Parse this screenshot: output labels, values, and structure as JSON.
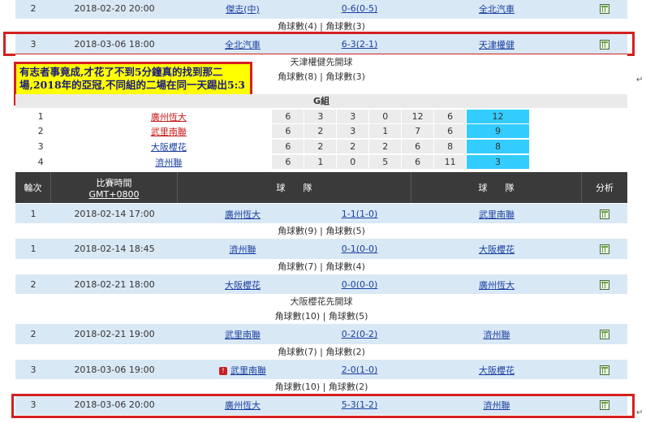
{
  "top_rows": [
    {
      "round": "2",
      "time": "2018-02-20 20:00",
      "home": "傑志(中)",
      "score": "0-6(0-5)",
      "away": "全北汽車",
      "sub": "角球數(4) | 角球數(3)"
    },
    {
      "round": "3",
      "time": "2018-03-06 18:00",
      "home": "全北汽車",
      "score": "6-3(2-1)",
      "away": "天津權健",
      "sub1": "天津權健先開球",
      "sub2": "角球數(8) | 角球數(3)"
    }
  ],
  "note": "有志者事竟成,才花了不到5分鐘真的找到那二場,2018年的亞冠,不同組的二場在同一天踢出5:3",
  "group": {
    "title": "G組",
    "rows": [
      {
        "rank": "1",
        "team": "廣州恆大",
        "p": "6",
        "w": "3",
        "d": "3",
        "l": "0",
        "gf": "12",
        "ga": "6",
        "pts": "12",
        "style": "red"
      },
      {
        "rank": "2",
        "team": "武里南聯",
        "p": "6",
        "w": "2",
        "d": "3",
        "l": "1",
        "gf": "7",
        "ga": "6",
        "pts": "9",
        "style": "red"
      },
      {
        "rank": "3",
        "team": "大阪櫻花",
        "p": "6",
        "w": "2",
        "d": "2",
        "l": "2",
        "gf": "6",
        "ga": "8",
        "pts": "8",
        "style": "blue"
      },
      {
        "rank": "4",
        "team": "濟州聯",
        "p": "6",
        "w": "1",
        "d": "0",
        "l": "5",
        "gf": "6",
        "ga": "11",
        "pts": "3",
        "style": "blue"
      }
    ]
  },
  "header": {
    "round": "輪次",
    "time": "比賽時間",
    "time_sub": "GMT+0800",
    "team_home": "球　　隊",
    "team_away": "球　　隊",
    "analysis": "分析"
  },
  "matches": [
    {
      "round": "1",
      "time": "2018-02-14 17:00",
      "home": "廣州恆大",
      "score": "1-1(1-0)",
      "away": "武里南聯",
      "sub": "角球數(9) | 角球數(5)"
    },
    {
      "round": "1",
      "time": "2018-02-14 18:45",
      "home": "濟州聯",
      "score": "0-1(0-0)",
      "away": "大阪櫻花",
      "sub": "角球數(7) | 角球數(4)"
    },
    {
      "round": "2",
      "time": "2018-02-21 18:00",
      "home": "大阪櫻花",
      "score": "0-0(0-0)",
      "away": "廣州恆大",
      "sub1": "大阪櫻花先開球",
      "sub2": "角球數(10) | 角球數(5)"
    },
    {
      "round": "2",
      "time": "2018-02-21 19:00",
      "home": "武里南聯",
      "score": "0-2(0-2)",
      "away": "濟州聯",
      "sub": "角球數(7) | 角球數(2)"
    },
    {
      "round": "3",
      "time": "2018-03-06 19:00",
      "home": "武里南聯",
      "score": "2-0(1-0)",
      "away": "大阪櫻花",
      "sub": "角球數(10) | 角球數(2)",
      "flag": "!"
    },
    {
      "round": "3",
      "time": "2018-03-06 20:00",
      "home": "廣州恆大",
      "score": "5-3(1-2)",
      "away": "濟州聯"
    }
  ],
  "return_mark": "↵"
}
